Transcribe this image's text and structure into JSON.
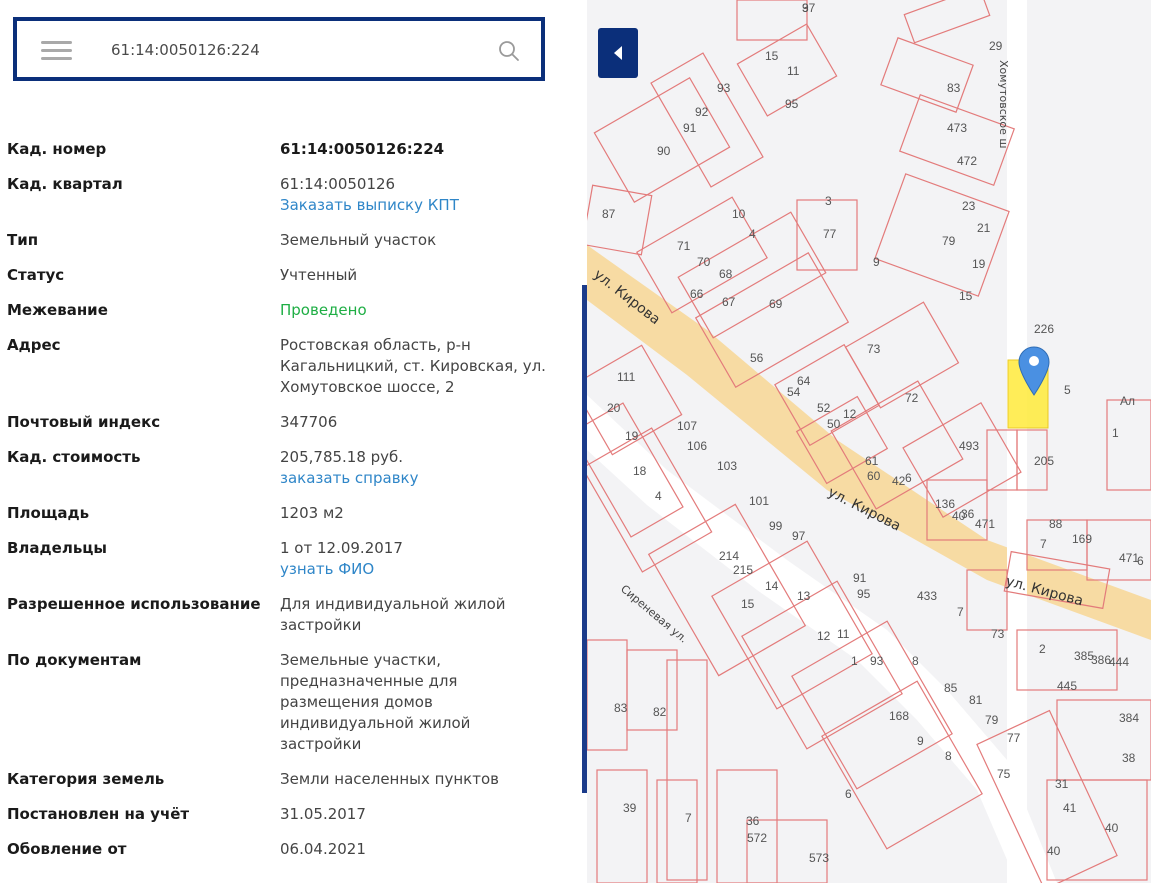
{
  "search": {
    "value": "61:14:0050126:224"
  },
  "info": {
    "rows": [
      {
        "label": "Кад. номер",
        "value": "61:14:0050126:224"
      },
      {
        "label": "Кад. квартал",
        "value": "61:14:0050126",
        "link": "Заказать выписку КПТ"
      },
      {
        "label": "Тип",
        "value": "Земельный участок"
      },
      {
        "label": "Статус",
        "value": "Учтенный"
      },
      {
        "label": "Межевание",
        "value": "Проведено"
      },
      {
        "label": "Адрес",
        "value": "Ростовская область, р-н Кагальницкий, ст. Кировская, ул. Хомутовское шоссе, 2"
      },
      {
        "label": "Почтовый индекс",
        "value": "347706"
      },
      {
        "label": "Кад. стоимость",
        "value": "205,785.18 руб.",
        "link": "заказать справку"
      },
      {
        "label": "Площадь",
        "value": "1203 м2"
      },
      {
        "label": "Владельцы",
        "value": "1 от 12.09.2017",
        "link": "узнать ФИО"
      },
      {
        "label": "Разрешенное использование",
        "value": "Для индивидуальной жилой застройки"
      },
      {
        "label": "По документам",
        "value": "Земельные участки, предназначенные для размещения домов индивидуальной жилой застройки"
      },
      {
        "label": "Категория земель",
        "value": "Земли населенных пунктов"
      },
      {
        "label": "Постановлен на учёт",
        "value": "31.05.2017"
      },
      {
        "label": "Обовление от",
        "value": "06.04.2021"
      }
    ]
  },
  "map": {
    "streets": {
      "kirova": "ул. Кирова",
      "khomutovskoe": "Хомутовское ш",
      "sirenevaya": "Сиреневая ул."
    },
    "parcel_labels": [
      "97",
      "15",
      "11",
      "95",
      "93",
      "92",
      "91",
      "90",
      "87",
      "83",
      "473",
      "472",
      "29",
      "23",
      "21",
      "19",
      "79",
      "77",
      "71",
      "70",
      "68",
      "4",
      "67",
      "69",
      "66",
      "56",
      "10",
      "3",
      "9",
      "15",
      "73",
      "72",
      "64",
      "54",
      "52",
      "50",
      "12",
      "61",
      "60",
      "42",
      "6",
      "136",
      "40",
      "36",
      "471",
      "493",
      "205",
      "226",
      "111",
      "20",
      "19",
      "18",
      "4",
      "107",
      "106",
      "103",
      "101",
      "99",
      "97",
      "214",
      "215",
      "15",
      "14",
      "13",
      "12",
      "11",
      "1",
      "93",
      "95",
      "91",
      "88",
      "7",
      "169",
      "471",
      "433",
      "7",
      "73",
      "385",
      "386",
      "444",
      "445",
      "384",
      "2",
      "82",
      "83",
      "39",
      "7",
      "36",
      "572",
      "573",
      "8",
      "85",
      "81",
      "79",
      "77",
      "75",
      "31",
      "41",
      "40",
      "40",
      "38",
      "168",
      "9",
      "8",
      "6",
      "1",
      "6",
      "Ал",
      "5",
      "3"
    ],
    "colors": {
      "parcel": "#e37b7b",
      "road": "#f7d89a",
      "selected": "#ffeb3b",
      "marker": "#4a90e2"
    }
  }
}
